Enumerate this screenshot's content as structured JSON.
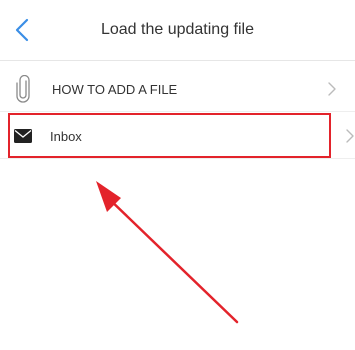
{
  "header": {
    "title": "Load the updating file",
    "back_icon": "chevron-left-icon"
  },
  "list": {
    "items": [
      {
        "label": "HOW TO ADD A FILE",
        "icon": "paperclip-icon"
      },
      {
        "label": "Inbox",
        "icon": "envelope-icon"
      }
    ]
  },
  "annotation": {
    "highlight_color": "#e3232b",
    "arrow_color": "#e3232b"
  },
  "colors": {
    "accent": "#3a8ee6",
    "text": "#333333",
    "chevron": "#bbbbbb"
  }
}
